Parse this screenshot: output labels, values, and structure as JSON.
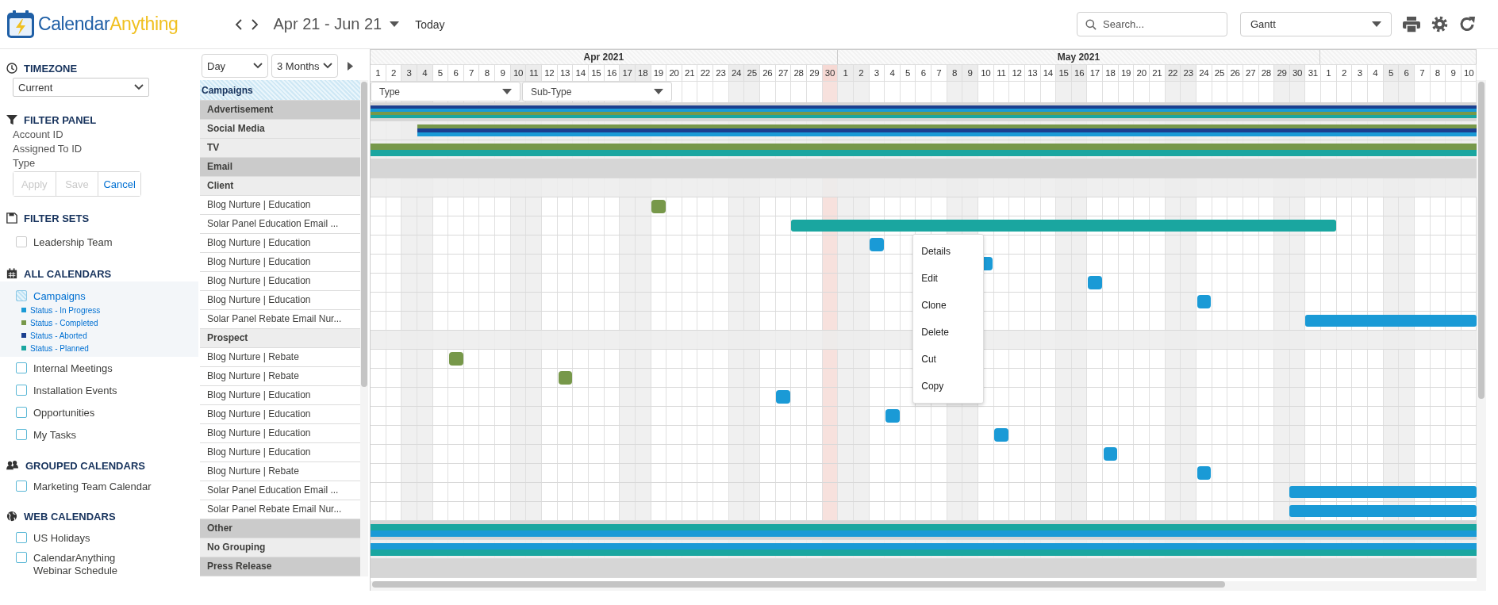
{
  "header": {
    "logo": [
      "Calendar",
      "Anything"
    ],
    "range": "Apr 21 - Jun 21",
    "today": "Today",
    "search": {
      "placeholder": "Search..."
    },
    "view": "Gantt"
  },
  "sidebar": {
    "timezone": {
      "title": "TIMEZONE",
      "value": "Current"
    },
    "filter_panel": {
      "title": "FILTER PANEL",
      "fields": [
        "Account ID",
        "Assigned To ID",
        "Type"
      ],
      "buttons": [
        {
          "label": "Apply",
          "disabled": true
        },
        {
          "label": "Save",
          "disabled": true
        },
        {
          "label": "Cancel",
          "disabled": false
        }
      ]
    },
    "filter_sets": {
      "title": "FILTER SETS",
      "items": [
        {
          "label": "Leadership Team",
          "checked": false
        }
      ]
    },
    "all_calendars": {
      "title": "ALL CALENDARS",
      "items": [
        {
          "label": "Campaigns",
          "selected": true,
          "checked": true,
          "legend": [
            {
              "label": "Status - In Progress",
              "color": "#1a9ad6"
            },
            {
              "label": "Status - Completed",
              "color": "#77984a"
            },
            {
              "label": "Status - Aborted",
              "color": "#1b3f8f"
            },
            {
              "label": "Status - Planned",
              "color": "#1aa6a0"
            }
          ]
        },
        {
          "label": "Internal Meetings",
          "selected": false,
          "checked": false
        },
        {
          "label": "Installation Events",
          "selected": false,
          "checked": false
        },
        {
          "label": "Opportunities",
          "selected": false,
          "checked": false
        },
        {
          "label": "My Tasks",
          "selected": false,
          "checked": false
        }
      ]
    },
    "grouped_calendars": {
      "title": "GROUPED CALENDARS",
      "items": [
        {
          "label": "Marketing Team Calendar",
          "selected": false,
          "checked": false
        }
      ]
    },
    "web_calendars": {
      "title": "WEB CALENDARS",
      "items": [
        {
          "label": "US Holidays",
          "selected": false,
          "checked": false
        },
        {
          "label": "CalendarAnything Webinar Schedule",
          "selected": false,
          "checked": false
        }
      ]
    }
  },
  "gantt": {
    "period": "Day",
    "span": "3 Months",
    "calendar": "Campaigns",
    "filters": [
      {
        "placeholder": "Type"
      },
      {
        "placeholder": "Sub-Type"
      }
    ],
    "months": [
      {
        "label": "Apr 2021",
        "days": [
          {
            "label": "1",
            "weekend": false,
            "today": false
          },
          {
            "label": "2",
            "weekend": false,
            "today": false
          },
          {
            "label": "3",
            "weekend": true,
            "today": false
          },
          {
            "label": "4",
            "weekend": true,
            "today": false
          },
          {
            "label": "5",
            "weekend": false,
            "today": false
          },
          {
            "label": "6",
            "weekend": false,
            "today": false
          },
          {
            "label": "7",
            "weekend": false,
            "today": false
          },
          {
            "label": "8",
            "weekend": false,
            "today": false
          },
          {
            "label": "9",
            "weekend": false,
            "today": false
          },
          {
            "label": "10",
            "weekend": true,
            "today": false
          },
          {
            "label": "11",
            "weekend": true,
            "today": false
          },
          {
            "label": "12",
            "weekend": false,
            "today": false
          },
          {
            "label": "13",
            "weekend": false,
            "today": false
          },
          {
            "label": "14",
            "weekend": false,
            "today": false
          },
          {
            "label": "15",
            "weekend": false,
            "today": false
          },
          {
            "label": "16",
            "weekend": false,
            "today": false
          },
          {
            "label": "17",
            "weekend": true,
            "today": false
          },
          {
            "label": "18",
            "weekend": true,
            "today": false
          },
          {
            "label": "19",
            "weekend": false,
            "today": false
          },
          {
            "label": "20",
            "weekend": false,
            "today": false
          },
          {
            "label": "21",
            "weekend": false,
            "today": false
          },
          {
            "label": "22",
            "weekend": false,
            "today": false
          },
          {
            "label": "23",
            "weekend": false,
            "today": false
          },
          {
            "label": "24",
            "weekend": true,
            "today": false
          },
          {
            "label": "25",
            "weekend": true,
            "today": false
          },
          {
            "label": "26",
            "weekend": false,
            "today": false
          },
          {
            "label": "27",
            "weekend": false,
            "today": false
          },
          {
            "label": "28",
            "weekend": false,
            "today": false
          },
          {
            "label": "29",
            "weekend": false,
            "today": false
          },
          {
            "label": "30",
            "weekend": false,
            "today": true
          }
        ]
      },
      {
        "label": "May 2021",
        "days": [
          {
            "label": "1",
            "weekend": true,
            "today": false
          },
          {
            "label": "2",
            "weekend": true,
            "today": false
          },
          {
            "label": "3",
            "weekend": false,
            "today": false
          },
          {
            "label": "4",
            "weekend": false,
            "today": false
          },
          {
            "label": "5",
            "weekend": false,
            "today": false
          },
          {
            "label": "6",
            "weekend": false,
            "today": false
          },
          {
            "label": "7",
            "weekend": false,
            "today": false
          },
          {
            "label": "8",
            "weekend": true,
            "today": false
          },
          {
            "label": "9",
            "weekend": true,
            "today": false
          },
          {
            "label": "10",
            "weekend": false,
            "today": false
          },
          {
            "label": "11",
            "weekend": false,
            "today": false
          },
          {
            "label": "12",
            "weekend": false,
            "today": false
          },
          {
            "label": "13",
            "weekend": false,
            "today": false
          },
          {
            "label": "14",
            "weekend": false,
            "today": false
          },
          {
            "label": "15",
            "weekend": true,
            "today": false
          },
          {
            "label": "16",
            "weekend": true,
            "today": false
          },
          {
            "label": "17",
            "weekend": false,
            "today": false
          },
          {
            "label": "18",
            "weekend": false,
            "today": false
          },
          {
            "label": "19",
            "weekend": false,
            "today": false
          },
          {
            "label": "20",
            "weekend": false,
            "today": false
          },
          {
            "label": "21",
            "weekend": false,
            "today": false
          },
          {
            "label": "22",
            "weekend": true,
            "today": false
          },
          {
            "label": "23",
            "weekend": true,
            "today": false
          },
          {
            "label": "24",
            "weekend": false,
            "today": false
          },
          {
            "label": "25",
            "weekend": false,
            "today": false
          },
          {
            "label": "26",
            "weekend": false,
            "today": false
          },
          {
            "label": "27",
            "weekend": false,
            "today": false
          },
          {
            "label": "28",
            "weekend": false,
            "today": false
          },
          {
            "label": "29",
            "weekend": true,
            "today": false
          },
          {
            "label": "30",
            "weekend": true,
            "today": false
          },
          {
            "label": "31",
            "weekend": false,
            "today": false
          }
        ]
      },
      {
        "days": [
          {
            "label": "1",
            "weekend": false,
            "today": false
          },
          {
            "label": "2",
            "weekend": false,
            "today": false
          },
          {
            "label": "3",
            "weekend": false,
            "today": false
          },
          {
            "label": "4",
            "weekend": false,
            "today": false
          },
          {
            "label": "5",
            "weekend": true,
            "today": false
          },
          {
            "label": "6",
            "weekend": true,
            "today": false
          },
          {
            "label": "7",
            "weekend": false,
            "today": false
          },
          {
            "label": "8",
            "weekend": false,
            "today": false
          },
          {
            "label": "9",
            "weekend": false,
            "today": false
          },
          {
            "label": "10",
            "weekend": false,
            "today": false
          }
        ]
      }
    ],
    "rows": [
      {
        "kind": "group",
        "label": "Advertisement",
        "bars": [
          {
            "color": "#1b3f8f"
          },
          {
            "color": "#1a9ad6"
          },
          {
            "color": "#77984a"
          },
          {
            "color": "#1aa6a0"
          }
        ]
      },
      {
        "kind": "subgroup",
        "label": "Social Media",
        "bars": [
          {
            "color": "#77984a"
          },
          {
            "color": "#1b3f8f"
          },
          {
            "color": "#1a9ad6"
          }
        ]
      },
      {
        "kind": "subgroup",
        "label": "TV",
        "bars": [
          {
            "color": "#77984a"
          },
          {
            "color": "#1aa6a0"
          }
        ]
      },
      {
        "kind": "group",
        "label": "Email"
      },
      {
        "kind": "subgroup",
        "label": "Client"
      },
      {
        "kind": "item",
        "label": "Blog Nurture | Education",
        "bars": [
          {
            "color": "#77984a"
          }
        ]
      },
      {
        "kind": "item",
        "label": "Solar Panel Education Email ...",
        "bars": [
          {
            "color": "#1aa6a0"
          }
        ]
      },
      {
        "kind": "item",
        "label": "Blog Nurture | Education",
        "bars": [
          {
            "color": "#1a9ad6"
          }
        ]
      },
      {
        "kind": "item",
        "label": "Blog Nurture | Education",
        "bars": [
          {
            "color": "#1a9ad6"
          }
        ]
      },
      {
        "kind": "item",
        "label": "Blog Nurture | Education",
        "bars": [
          {
            "color": "#1a9ad6"
          }
        ]
      },
      {
        "kind": "item",
        "label": "Blog Nurture | Education",
        "bars": [
          {
            "color": "#1a9ad6"
          }
        ]
      },
      {
        "kind": "item",
        "label": "Solar Panel Rebate Email Nur...",
        "bars": [
          {
            "color": "#1a9ad6"
          }
        ]
      },
      {
        "kind": "subgroup",
        "label": "Prospect"
      },
      {
        "kind": "item",
        "label": "Blog Nurture | Rebate",
        "bars": [
          {
            "color": "#77984a"
          }
        ]
      },
      {
        "kind": "item",
        "label": "Blog Nurture | Rebate",
        "bars": [
          {
            "color": "#77984a"
          }
        ]
      },
      {
        "kind": "item",
        "label": "Blog Nurture | Education",
        "bars": [
          {
            "color": "#1a9ad6"
          }
        ]
      },
      {
        "kind": "item",
        "label": "Blog Nurture | Education",
        "bars": [
          {
            "color": "#1a9ad6"
          }
        ]
      },
      {
        "kind": "item",
        "label": "Blog Nurture | Education",
        "bars": [
          {
            "color": "#1a9ad6"
          }
        ]
      },
      {
        "kind": "item",
        "label": "Blog Nurture | Education",
        "bars": [
          {
            "color": "#1a9ad6"
          }
        ]
      },
      {
        "kind": "item",
        "label": "Blog Nurture | Rebate",
        "bars": [
          {
            "color": "#1a9ad6"
          }
        ]
      },
      {
        "kind": "item",
        "label": "Solar Panel Education Email ...",
        "bars": [
          {
            "color": "#1a9ad6"
          }
        ]
      },
      {
        "kind": "item",
        "label": "Solar Panel Rebate Email Nur...",
        "bars": [
          {
            "color": "#1a9ad6"
          }
        ]
      },
      {
        "kind": "group",
        "label": "Other",
        "bars": [
          {
            "color": "#1aa6a0"
          },
          {
            "color": "#1a9ad6"
          }
        ]
      },
      {
        "kind": "subgroup",
        "label": "No Grouping",
        "bars": [
          {
            "color": "#1a9ad6"
          },
          {
            "color": "#1aa6a0"
          }
        ]
      },
      {
        "kind": "group",
        "label": "Press Release"
      }
    ]
  },
  "context_menu": {
    "items": [
      "Details",
      "Edit",
      "Clone",
      "Delete",
      "Cut",
      "Copy"
    ]
  }
}
